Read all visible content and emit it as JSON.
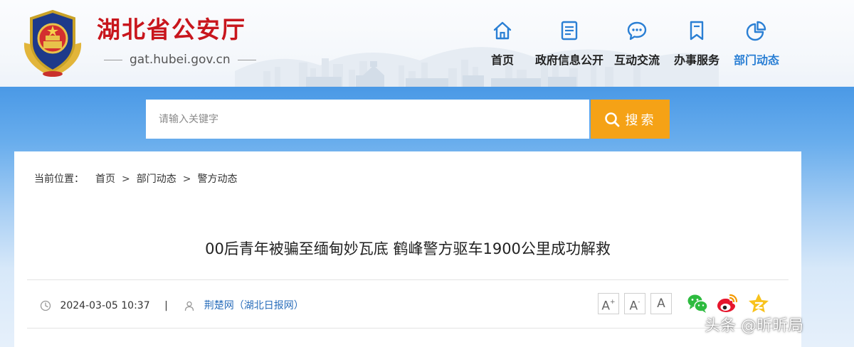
{
  "site": {
    "name": "湖北省公安厅",
    "domain": "gat.hubei.gov.cn"
  },
  "nav": {
    "items": [
      {
        "label": "首页",
        "icon": "home-icon"
      },
      {
        "label": "政府信息公开",
        "icon": "document-icon"
      },
      {
        "label": "互动交流",
        "icon": "chat-icon"
      },
      {
        "label": "办事服务",
        "icon": "bookmark-icon"
      },
      {
        "label": "部门动态",
        "icon": "pie-chart-icon",
        "active": true
      }
    ],
    "active_color": "#2a7fd4"
  },
  "search": {
    "placeholder": "请输入关键字",
    "button_label": "搜索",
    "button_color": "#f5a216"
  },
  "breadcrumb": {
    "lead": "当前位置：",
    "items": [
      "首页",
      "部门动态",
      "警方动态"
    ],
    "separator": ">"
  },
  "article": {
    "title": "00后青年被骗至缅甸妙瓦底 鹤峰警方驱车1900公里成功解救",
    "date": "2024-03-05 10:37",
    "divider": "|",
    "source": "荆楚网（湖北日报网）"
  },
  "font_controls": {
    "increase": "A",
    "decrease": "A",
    "reset": "A",
    "increase_mark": "+",
    "decrease_mark": "-"
  },
  "share": [
    "wechat-icon",
    "weibo-icon",
    "qzone-icon"
  ],
  "watermark": "头条 @昕昕局"
}
